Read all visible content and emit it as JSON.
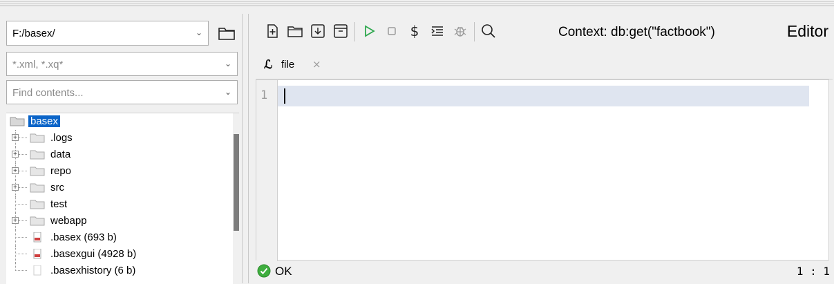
{
  "left_panel": {
    "path_value": "F:/basex/",
    "filter_placeholder": "*.xml, *.xq*",
    "search_placeholder": "Find contents...",
    "tree": [
      {
        "label": "basex",
        "type": "folder",
        "expandable": false,
        "selected": true,
        "root": true
      },
      {
        "label": ".logs",
        "type": "folder",
        "expandable": true
      },
      {
        "label": "data",
        "type": "folder",
        "expandable": true
      },
      {
        "label": "repo",
        "type": "folder",
        "expandable": true
      },
      {
        "label": "src",
        "type": "folder",
        "expandable": true
      },
      {
        "label": "test",
        "type": "folder",
        "expandable": false
      },
      {
        "label": "webapp",
        "type": "folder",
        "expandable": true
      },
      {
        "label": ".basex (693 b)",
        "type": "file",
        "expandable": false
      },
      {
        "label": ".basexgui (4928 b)",
        "type": "file",
        "expandable": false
      },
      {
        "label": ".basexhistory (6 b)",
        "type": "file-plain",
        "expandable": false
      }
    ]
  },
  "toolbar": {
    "icons": [
      "new-file-icon",
      "open-folder-icon",
      "save-icon",
      "archive-icon",
      "run-icon",
      "stop-icon",
      "dollar-icon",
      "format-icon",
      "debug-icon",
      "search-icon"
    ],
    "context_label": "Context: db:get(\"factbook\")",
    "panel_title": "Editor",
    "accent": "#2fa84f"
  },
  "tabs": [
    {
      "label": "file",
      "icon": "xquery-file-icon",
      "close": "⨯"
    }
  ],
  "editor": {
    "line_numbers": [
      "1"
    ]
  },
  "status": {
    "message": "OK",
    "cursor_position": "1 : 1"
  },
  "colors": {
    "selection": "#0a64c8",
    "current_line": "#dfe5f0",
    "ok_green": "#3fae3f"
  }
}
